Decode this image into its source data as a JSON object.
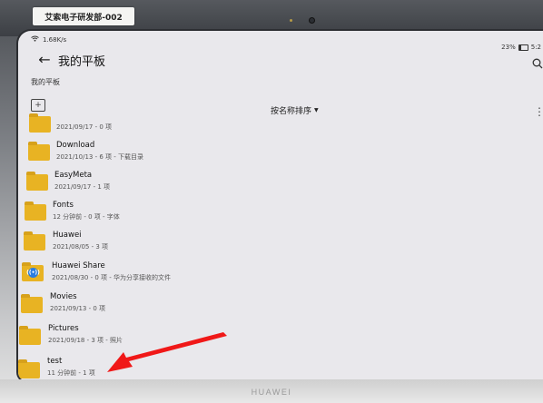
{
  "sticker": {
    "label": "艾索电子研发部-002"
  },
  "brand": {
    "label": "HUAWEI"
  },
  "status": {
    "left_text": "1.68K/s",
    "battery_text": "23%",
    "time_text": "5:2"
  },
  "header": {
    "title": "我的平板",
    "back_icon": "arrow-left-icon",
    "search_icon": "search-icon"
  },
  "breadcrumb": "我的平板",
  "toolbar": {
    "new_folder_icon": "new-folder-icon",
    "sort_label": "按名称排序",
    "more_icon": "more-icon"
  },
  "files": [
    {
      "name": "",
      "meta": "2021/09/17 - 0 项"
    },
    {
      "name": "Download",
      "meta": "2021/10/13 - 6 项 - 下载目录"
    },
    {
      "name": "EasyMeta",
      "meta": "2021/09/17 - 1 项"
    },
    {
      "name": "Fonts",
      "meta": "12 分钟前 - 0 项 - 字体"
    },
    {
      "name": "Huawei",
      "meta": "2021/08/05 - 3 项"
    },
    {
      "name": "Huawei Share",
      "meta": "2021/08/30 - 0 项 - 华为分享接收的文件"
    },
    {
      "name": "Movies",
      "meta": "2021/09/13 - 0 项"
    },
    {
      "name": "Pictures",
      "meta": "2021/09/18 - 3 项 - 照片"
    },
    {
      "name": "test",
      "meta": "11 分钟前 - 1 项"
    }
  ],
  "annotation": {
    "arrow_color": "#f01818"
  }
}
